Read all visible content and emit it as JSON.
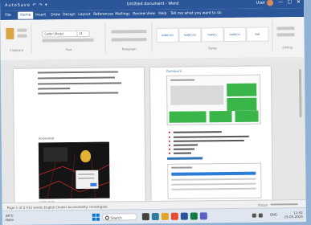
{
  "window": {
    "quick_access": "AutoSave ↶ ↷ ▾",
    "title": "Untitled document - Word",
    "user": "User",
    "minimize": "—",
    "maximize": "☐",
    "close": "✕"
  },
  "menu": {
    "tabs": [
      "File",
      "Home",
      "Insert",
      "Draw",
      "Design",
      "Layout",
      "References",
      "Mailings",
      "Review",
      "View",
      "Help",
      "Tell me what you want to do"
    ]
  },
  "ribbon": {
    "font_name": "Calibri (Body)",
    "font_size": "11",
    "groups": [
      "Clipboard",
      "Font",
      "Paragraph",
      "Styles",
      "Editing"
    ],
    "styles": [
      "AaBbCcDc",
      "AaBbCcDc",
      "AaBbCc",
      "AaBbCcC",
      "AaB"
    ]
  },
  "document": {
    "left_caption_1": "Screenshot",
    "left_caption_2": "Login page",
    "right_heading": "Dashboard"
  },
  "statusbar": {
    "left": "Page 1 of 2    412 words    English (India)    Accessibility: Investigate",
    "right": "Focus"
  },
  "taskbar": {
    "weather_temp": "28°C",
    "weather_desc": "Haze",
    "search_placeholder": "Search",
    "language": "ENG",
    "time": "11:42",
    "date": "15-05-2023"
  },
  "colors": {
    "word_blue": "#2b579a",
    "green_tile": "#39b54a",
    "bullet_red": "#c00000"
  }
}
